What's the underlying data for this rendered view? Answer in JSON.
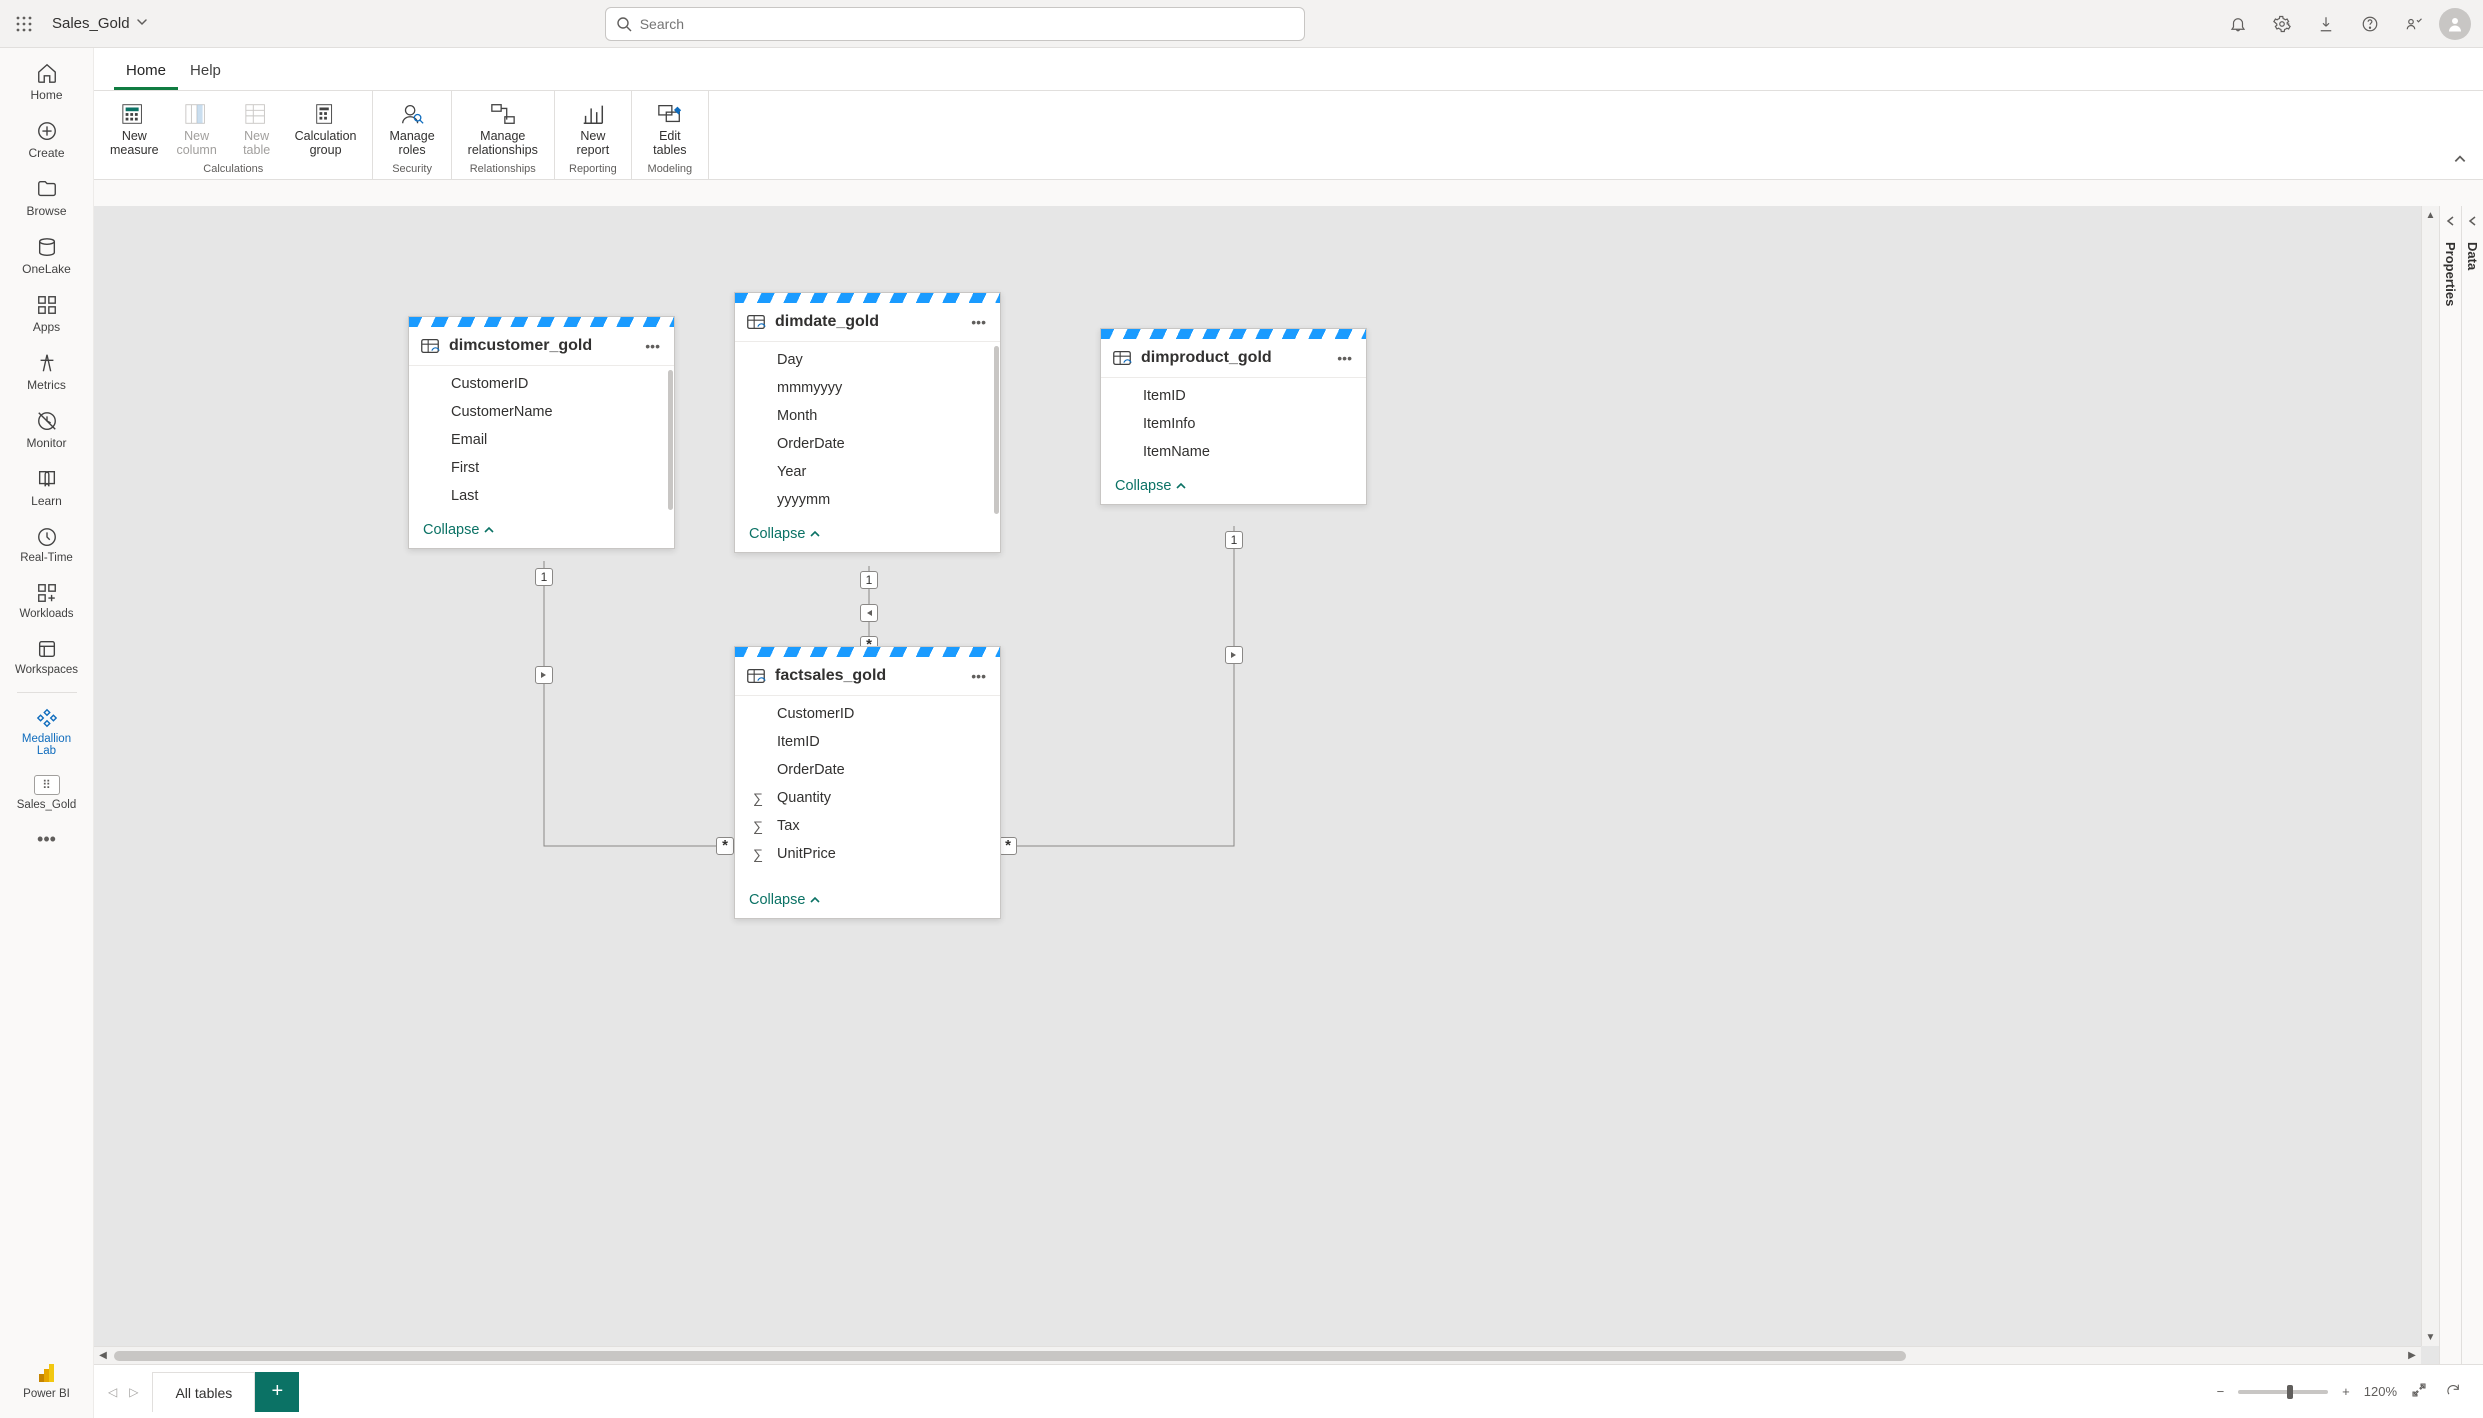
{
  "app_title": "Sales_Gold",
  "search_placeholder": "Search",
  "tabs": {
    "home": "Home",
    "help": "Help"
  },
  "ribbon": {
    "new_measure": "New\nmeasure",
    "new_column": "New\ncolumn",
    "new_table": "New\ntable",
    "calc_group": "Calculation\ngroup",
    "calc_label": "Calculations",
    "manage_roles": "Manage\nroles",
    "security_label": "Security",
    "manage_rel": "Manage\nrelationships",
    "rel_label": "Relationships",
    "new_report": "New\nreport",
    "reporting_label": "Reporting",
    "edit_tables": "Edit\ntables",
    "modeling_label": "Modeling"
  },
  "leftrail": {
    "home": "Home",
    "create": "Create",
    "browse": "Browse",
    "onelake": "OneLake",
    "apps": "Apps",
    "metrics": "Metrics",
    "monitor": "Monitor",
    "learn": "Learn",
    "realtime": "Real-Time",
    "workloads": "Workloads",
    "workspaces": "Workspaces",
    "medallion": "Medallion\nLab",
    "salesgold": "Sales_Gold",
    "powerbi": "Power BI"
  },
  "rightpanes": {
    "properties": "Properties",
    "data": "Data"
  },
  "collapse_label": "Collapse",
  "tables": {
    "dimcustomer": {
      "name": "dimcustomer_gold",
      "cols": [
        "CustomerID",
        "CustomerName",
        "Email",
        "First",
        "Last"
      ]
    },
    "dimdate": {
      "name": "dimdate_gold",
      "cols": [
        "Day",
        "mmmyyyy",
        "Month",
        "OrderDate",
        "Year",
        "yyyymm"
      ]
    },
    "dimproduct": {
      "name": "dimproduct_gold",
      "cols": [
        "ItemID",
        "ItemInfo",
        "ItemName"
      ]
    },
    "factsales": {
      "name": "factsales_gold",
      "cols": [
        {
          "n": "CustomerID",
          "m": false
        },
        {
          "n": "ItemID",
          "m": false
        },
        {
          "n": "OrderDate",
          "m": false
        },
        {
          "n": "Quantity",
          "m": true
        },
        {
          "n": "Tax",
          "m": true
        },
        {
          "n": "UnitPrice",
          "m": true
        }
      ]
    }
  },
  "bottom": {
    "sheet": "All tables",
    "zoom": "120%"
  },
  "card_one": "1",
  "card_many": "*"
}
